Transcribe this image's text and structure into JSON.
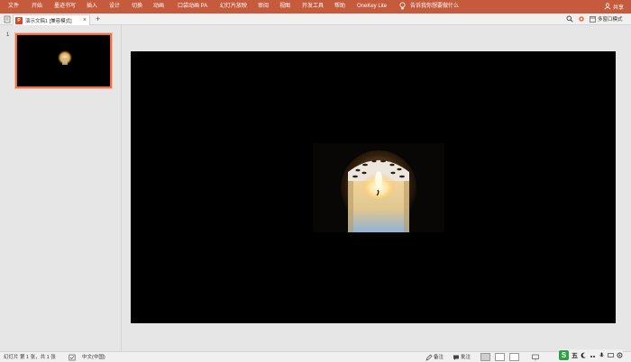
{
  "ribbon": {
    "tabs": [
      "文件",
      "开始",
      "墨迹书写",
      "插入",
      "设计",
      "切换",
      "动画",
      "口袋动画 PA",
      "幻灯片放映",
      "审阅",
      "视图",
      "开发工具",
      "帮助",
      "OneKey Lite"
    ],
    "tell_me": "告诉我你想要做什么",
    "share": "共享"
  },
  "tabbar": {
    "doc_title": "演示文稿1 [兼容模式]",
    "ppt_badge": "P",
    "close": "×",
    "add": "+",
    "multi_window": "多窗口模式"
  },
  "thumbnails": [
    {
      "number": "1"
    }
  ],
  "statusbar": {
    "slide_info": "幻灯片 第 1 张，共 1 张",
    "language": "中文(中国)",
    "notes": "备注",
    "comments": "批注"
  },
  "ime": {
    "mode": "五",
    "icons": [
      "moon-icon",
      "punctuation-icon",
      "microphone-icon",
      "keyboard-icon",
      "gear-icon"
    ]
  },
  "colors": {
    "ribbon": "#c55a3c",
    "thumb_border": "#e8734a",
    "slide_bg": "#000000"
  }
}
